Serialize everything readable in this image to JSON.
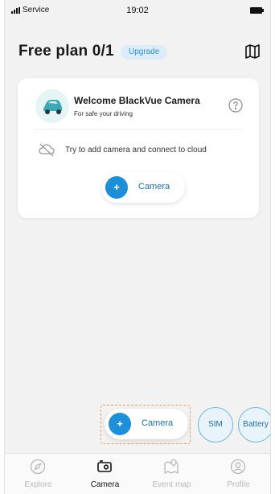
{
  "status_bar": {
    "carrier": "Service",
    "time": "19:02"
  },
  "header": {
    "plan_title": "Free plan 0/1",
    "upgrade_label": "Upgrade"
  },
  "welcome_card": {
    "title": "Welcome BlackVue Camera",
    "subtitle": "For safe your driving",
    "cloud_message": "Try to add camera and connect to cloud",
    "add_camera_label": "Camera"
  },
  "floating_actions": {
    "camera_label": "Camera",
    "sim_label": "SIM",
    "battery_label": "Battery"
  },
  "bottom_nav": {
    "items": [
      {
        "label": "Explore",
        "icon": "compass-icon",
        "active": false
      },
      {
        "label": "Camera",
        "icon": "camera-icon",
        "active": true
      },
      {
        "label": "Event map",
        "icon": "map-pin-icon",
        "active": false
      },
      {
        "label": "Profile",
        "icon": "profile-icon",
        "active": false
      }
    ]
  },
  "colors": {
    "accent": "#1e8fd6",
    "upgrade_badge_bg": "#dcecf8",
    "background": "#f2f2f2",
    "highlight_outline": "#e5a06a"
  }
}
